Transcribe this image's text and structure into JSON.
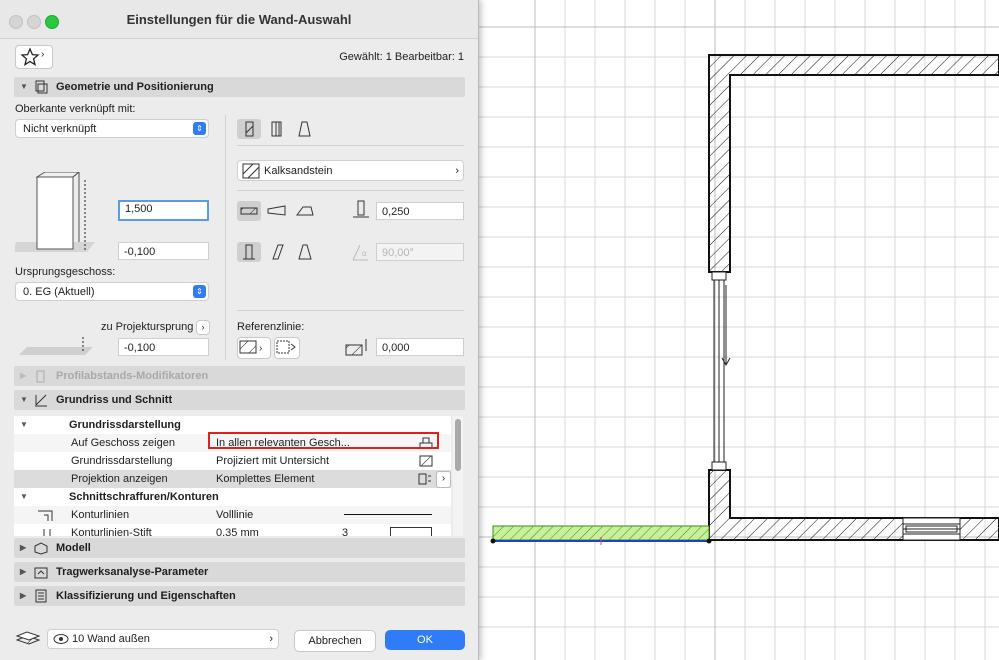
{
  "window": {
    "title": "Einstellungen für die Wand-Auswahl",
    "selection_info": "Gewählt: 1 Bearbeitbar: 1"
  },
  "sections": {
    "geometry": "Geometrie und Positionierung",
    "profile": "Profilabstands-Modifikatoren",
    "floorplan": "Grundriss und Schnitt",
    "model": "Modell",
    "structural": "Tragwerksanalyse-Parameter",
    "classification": "Klassifizierung und Eigenschaften"
  },
  "geometry": {
    "top_link_label": "Oberkante verknüpft mit:",
    "top_link_value": "Nicht verknüpft",
    "height_value": "1,500",
    "bottom_offset_value": "-0,100",
    "home_story_label": "Ursprungsgeschoss:",
    "home_story_value": "0. EG (Aktuell)",
    "to_project_zero_label": "zu Projektursprung",
    "project_offset_value": "-0,100",
    "material": "Kalksandstein",
    "thickness_value": "0,250",
    "angle_value": "90,00°",
    "reference_line_label": "Referenzlinie:",
    "reference_offset_value": "0,000"
  },
  "tree": {
    "group1": "Grundrissdarstellung",
    "group2": "Schnittschraffuren/Konturen",
    "rows": [
      {
        "label": "Auf Geschoss zeigen",
        "value": "In allen relevanten Gesch..."
      },
      {
        "label": "Grundrissdarstellung",
        "value": "Projiziert mit Untersicht"
      },
      {
        "label": "Projektion anzeigen",
        "value": "Komplettes Element"
      },
      {
        "label": "Konturlinien",
        "value": "Volllinie"
      },
      {
        "label": "Konturlinien-Stift",
        "value": "0,35 mm",
        "extra": "3"
      }
    ]
  },
  "footer": {
    "favorite_name": "10 Wand außen",
    "cancel": "Abbrechen",
    "ok": "OK"
  },
  "colors": {
    "accent": "#2f7cf6",
    "highlight_box": "#e0201a",
    "selected_wall_fill": "#8fd15a",
    "reference_line": "#1f3fd6"
  }
}
